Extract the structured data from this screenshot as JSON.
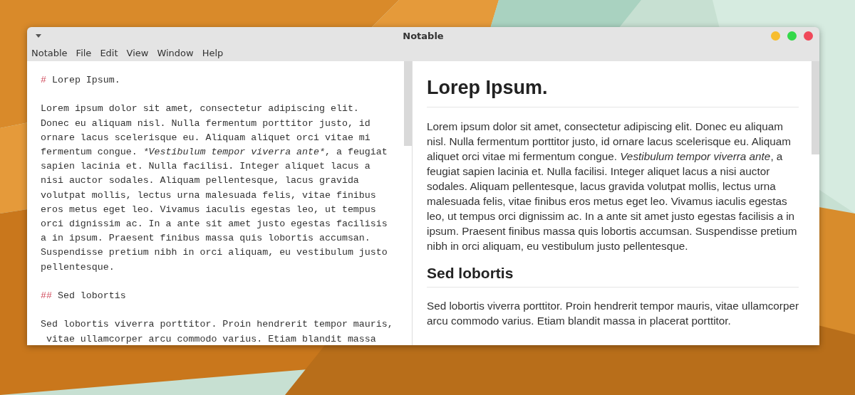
{
  "window": {
    "title": "Notable"
  },
  "traffic_lights": [
    {
      "color": "#f7bd2e"
    },
    {
      "color": "#34d84a"
    },
    {
      "color": "#f0485a"
    }
  ],
  "menu": [
    "Notable",
    "File",
    "Edit",
    "View",
    "Window",
    "Help"
  ],
  "editor": {
    "blocks": [
      {
        "kind": "heading",
        "marker": "#",
        "text": "Lorep Ipsum."
      },
      {
        "kind": "paragraph",
        "lines": [
          {
            "runs": [
              {
                "text": "Lorem ipsum dolor sit amet, consectetur adipiscing elit.",
                "italic": false
              }
            ]
          },
          {
            "runs": [
              {
                "text": "Donec eu aliquam nisl. Nulla fermentum porttitor justo, id",
                "italic": false
              }
            ]
          },
          {
            "runs": [
              {
                "text": "ornare lacus scelerisque eu. Aliquam aliquet orci vitae mi",
                "italic": false
              }
            ]
          },
          {
            "runs": [
              {
                "text": "fermentum congue. ",
                "italic": false
              },
              {
                "text": "*Vestibulum tempor viverra ante*",
                "italic": true
              },
              {
                "text": ", a feugiat",
                "italic": false
              }
            ]
          },
          {
            "runs": [
              {
                "text": "sapien lacinia et. Nulla facilisi. Integer aliquet lacus a",
                "italic": false
              }
            ]
          },
          {
            "runs": [
              {
                "text": "nisi auctor sodales. Aliquam pellentesque, lacus gravida",
                "italic": false
              }
            ]
          },
          {
            "runs": [
              {
                "text": "volutpat mollis, lectus urna malesuada felis, vitae finibus",
                "italic": false
              }
            ]
          },
          {
            "runs": [
              {
                "text": "eros metus eget leo. Vivamus iaculis egestas leo, ut tempus",
                "italic": false
              }
            ]
          },
          {
            "runs": [
              {
                "text": "orci dignissim ac. In a ante sit amet justo egestas facilisis",
                "italic": false
              }
            ]
          },
          {
            "runs": [
              {
                "text": "a in ipsum. Praesent finibus massa quis lobortis accumsan.",
                "italic": false
              }
            ]
          },
          {
            "runs": [
              {
                "text": "Suspendisse pretium nibh in orci aliquam, eu vestibulum justo",
                "italic": false
              }
            ]
          },
          {
            "runs": [
              {
                "text": "pellentesque.",
                "italic": false
              }
            ]
          }
        ]
      },
      {
        "kind": "heading",
        "marker": "##",
        "text": "Sed lobortis"
      },
      {
        "kind": "paragraph",
        "lines": [
          {
            "runs": [
              {
                "text": "Sed lobortis viverra porttitor. Proin hendrerit tempor mauris,",
                "italic": false
              }
            ]
          },
          {
            "runs": [
              {
                "text": " vitae ullamcorper arcu commodo varius. Etiam blandit massa",
                "italic": false
              }
            ]
          }
        ]
      }
    ]
  },
  "preview": {
    "blocks": [
      {
        "kind": "h1",
        "text": "Lorep Ipsum."
      },
      {
        "kind": "paragraph",
        "text": "Lorem ipsum dolor sit amet, consectetur adipiscing elit. Donec eu aliquam nisl. Nulla fermentum porttitor justo, id ornare lacus scelerisque eu. Aliquam aliquet orci vitae mi fermentum congue. *Vestibulum tempor viverra ante*, a feugiat sapien lacinia et. Nulla facilisi. Integer aliquet lacus a nisi auctor sodales. Aliquam pellentesque, lacus gravida volutpat mollis, lectus urna malesuada felis, vitae finibus eros metus eget leo. Vivamus iaculis egestas leo, ut tempus orci dignissim ac. In a ante sit amet justo egestas facilisis a in ipsum. Praesent finibus massa quis lobortis accumsan. Suspendisse pretium nibh in orci aliquam, eu vestibulum justo pellentesque."
      },
      {
        "kind": "h2",
        "text": "Sed lobortis"
      },
      {
        "kind": "paragraph",
        "text": "Sed lobortis viverra porttitor. Proin hendrerit tempor mauris, vitae ullamcorper arcu commodo varius. Etiam blandit massa in placerat porttitor."
      }
    ]
  }
}
